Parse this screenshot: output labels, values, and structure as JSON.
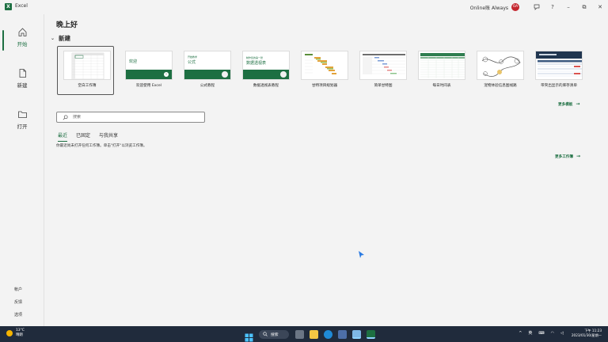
{
  "titlebar": {
    "app_title": "Excel",
    "user_name": "Online账 Always",
    "avatar_initials": "OA",
    "feedback_icon": "feedback-icon",
    "help_label": "?",
    "minimize_label": "–",
    "restore_label": "⧉",
    "close_label": "✕"
  },
  "sidebar": {
    "items": [
      {
        "label": "开始",
        "icon": "home-icon"
      },
      {
        "label": "新建",
        "icon": "new-document-icon"
      },
      {
        "label": "打开",
        "icon": "folder-icon"
      }
    ],
    "bottom": [
      "帐户",
      "反馈",
      "选项"
    ]
  },
  "main": {
    "greeting": "晚上好",
    "new_section_title": "新建",
    "templates": [
      {
        "label": "空白工作簿"
      },
      {
        "label": "欢迎使用 Excel",
        "thumb_text": "欢迎"
      },
      {
        "label": "公式教程",
        "thumb_text": "公式",
        "thumb_subtext": "开始教学"
      },
      {
        "label": "数据透视表教程",
        "thumb_text": "数据透视表",
        "thumb_subtext": "制作您的第一张"
      },
      {
        "label": "甘特项目规划器"
      },
      {
        "label": "简单甘特图"
      },
      {
        "label": "每日时间表"
      },
      {
        "label": "宠物体验信息图线路"
      },
      {
        "label": "带突出显示的库存清单"
      }
    ],
    "more_templates": "更多模板",
    "search_placeholder": "搜索",
    "tabs": [
      "最近",
      "已固定",
      "与我共享"
    ],
    "empty_message": "你最近尚未打开任何工作簿。单击\"打开\"以浏览工作簿。",
    "more_workbooks": "更多工作簿"
  },
  "taskbar": {
    "weather_temp": "13°C",
    "weather_desc": "晴朗",
    "search_label": "搜索",
    "ime_label": "英",
    "clock_time": "下午 11:23",
    "clock_date": "2023/01/30/星期一"
  },
  "colors": {
    "accent": "#1d6f42",
    "taskbar": "#202b3c",
    "avatar": "#c4262e"
  }
}
